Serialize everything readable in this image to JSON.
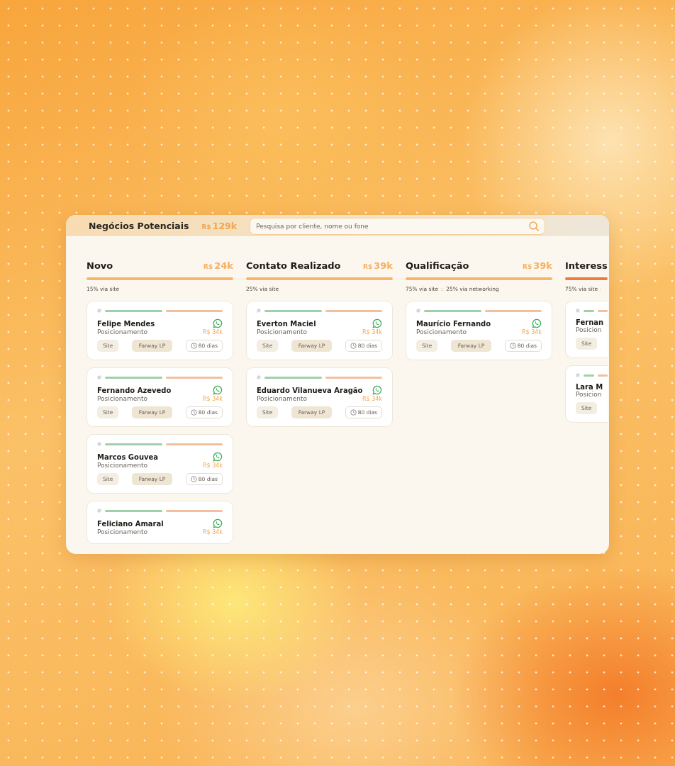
{
  "header": {
    "title": "Negócios Potenciais",
    "total": {
      "currency": "R$",
      "amount": "129k"
    },
    "search": {
      "placeholder": "Pesquisa por cliente, nome ou fone"
    }
  },
  "columns": [
    {
      "title": "Novo",
      "value": {
        "currency": "R$",
        "amount": "24k"
      },
      "color": "#f8b66a",
      "summary": [
        {
          "kind": "source",
          "text": "15% via site"
        }
      ],
      "cards": [
        {
          "name": "Felipe Mendes",
          "stage": "Posicionamento",
          "value": "R$ 34k",
          "tags": [
            "Site",
            "Farway LP"
          ],
          "duration": "80 dias"
        },
        {
          "name": "Fernando Azevedo",
          "stage": "Posicionamento",
          "value": "R$ 34k",
          "tags": [
            "Site",
            "Farway LP"
          ],
          "duration": "80 dias"
        },
        {
          "name": "Marcos Gouvea",
          "stage": "Posicionamento",
          "value": "R$ 34k",
          "tags": [
            "Site",
            "Farway LP"
          ],
          "duration": "80 dias"
        },
        {
          "name": "Feliciano Amaral",
          "stage": "Posicionamento",
          "value": "R$ 34k"
        }
      ]
    },
    {
      "title": "Contato Realizado",
      "value": {
        "currency": "R$",
        "amount": "39k"
      },
      "color": "#f8b66a",
      "summary": [
        {
          "kind": "source",
          "text": "25% via site"
        }
      ],
      "cards": [
        {
          "name": "Everton Maciel",
          "stage": "Posicionamento",
          "value": "R$ 34k",
          "tags": [
            "Site",
            "Farway LP"
          ],
          "duration": "80 dias"
        },
        {
          "name": "Eduardo Vilanueva Aragão",
          "stage": "Posicionamento",
          "value": "R$ 34k",
          "tags": [
            "Site",
            "Farway LP"
          ],
          "duration": "80 dias"
        }
      ]
    },
    {
      "title": "Qualificação",
      "value": {
        "currency": "R$",
        "amount": "39k"
      },
      "color": "#f8b66a",
      "summary": [
        {
          "kind": "source",
          "text": "75% via site"
        },
        {
          "kind": "separator",
          "text": "::"
        },
        {
          "kind": "source",
          "text": "25% via networking"
        }
      ],
      "cards": [
        {
          "name": "Maurício Fernando",
          "stage": "Posicionamento",
          "value": "R$ 34k",
          "tags": [
            "Site",
            "Farway LP"
          ],
          "duration": "80 dias"
        }
      ]
    },
    {
      "title": "Interess",
      "color": "#f07a3c",
      "summary": [
        {
          "kind": "source",
          "text": "75% via site"
        },
        {
          "kind": "separator",
          "text": ":"
        }
      ],
      "cards": [
        {
          "name": "Fernan",
          "stage": "Posicion",
          "tags": [
            "Site"
          ]
        },
        {
          "name": "Lara M",
          "stage": "Posicion",
          "tags": [
            "Site"
          ]
        }
      ]
    }
  ]
}
